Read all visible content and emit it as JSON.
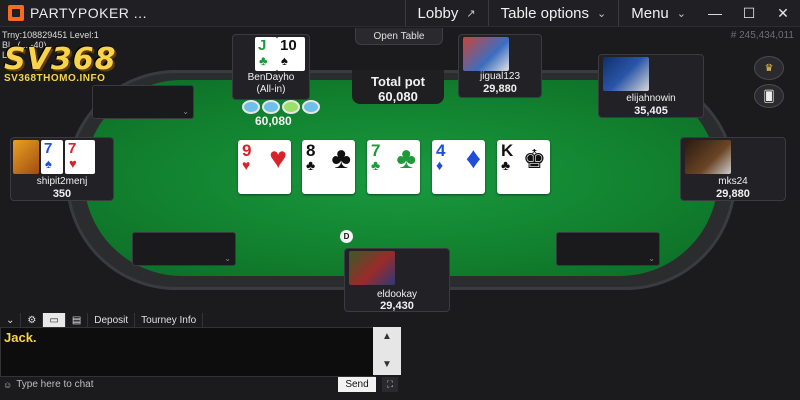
{
  "window": {
    "app_title": "PARTYPOKER ...",
    "lobby_label": "Lobby",
    "table_options_label": "Table options",
    "menu_label": "Menu",
    "minimize": "—",
    "maximize": "☐",
    "close": "✕"
  },
  "brand": {
    "name": "SV368",
    "url": "SV368THOMO.INFO"
  },
  "tourney": {
    "line1": "Trny:108829451 Level:1",
    "line2": "Bl...(... -40)",
    "line3": "Le..."
  },
  "hand_id": "# 245,434,011",
  "open_table_label": "Open Table",
  "pot": {
    "label": "Total pot",
    "amount": "60,080"
  },
  "bet": {
    "amount": "60,080"
  },
  "board": [
    {
      "rank": "9",
      "suit": "♥",
      "color": "#d6242a"
    },
    {
      "rank": "8",
      "suit": "♣",
      "color": "#111111"
    },
    {
      "rank": "7",
      "suit": "♣",
      "color": "#1f9a3a"
    },
    {
      "rank": "4",
      "suit": "♦",
      "color": "#1f4fd8"
    },
    {
      "rank": "K",
      "suit": "♣",
      "color": "#111111"
    }
  ],
  "seats": {
    "bendayho": {
      "name": "BenDayho",
      "status": "(All-in)",
      "cards": [
        {
          "rank": "J",
          "suit": "♣"
        },
        {
          "rank": "10",
          "suit": "♠"
        }
      ]
    },
    "jigual123": {
      "name": "jigual123",
      "stack": "29,880"
    },
    "elijahnowin": {
      "name": "elijahnowin",
      "stack": "35,405"
    },
    "shipit2menj": {
      "name": "shipit2menj",
      "stack": "350",
      "cards": [
        {
          "rank": "7",
          "suit": "♠"
        },
        {
          "rank": "7",
          "suit": "♥"
        }
      ]
    },
    "mks24": {
      "name": "mks24",
      "stack": "29,880"
    },
    "eldookay": {
      "name": "eldookay",
      "stack": "29,430"
    }
  },
  "dealer_label": "D",
  "chat": {
    "tabs": [
      "Deposit",
      "Tourney Info"
    ],
    "message": "Jack.",
    "input_placeholder": "Type here to chat",
    "send_label": "Send"
  },
  "colors": {
    "felt": "#12822f",
    "accent": "#ff6a1a",
    "brand": "#f7d44a"
  }
}
